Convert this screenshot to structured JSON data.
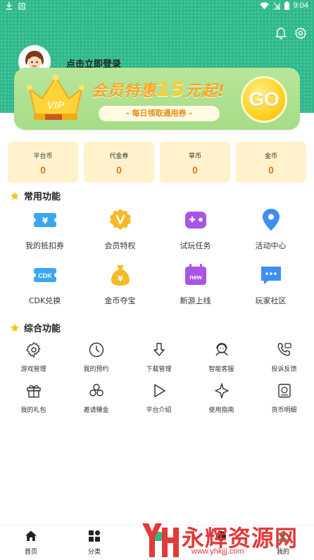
{
  "status_bar": {
    "time": "9:04"
  },
  "profile": {
    "login_prompt": "点击立即登录"
  },
  "vip_banner": {
    "crown_text": "VIP",
    "title_pre": "会员特惠",
    "title_num": "15",
    "title_post": "元起!",
    "subtitle": "- 每日领取通用券 -",
    "go_label": "GO"
  },
  "currencies": [
    {
      "label": "平台币",
      "value": "0"
    },
    {
      "label": "代金券",
      "value": "0"
    },
    {
      "label": "草币",
      "value": "0"
    },
    {
      "label": "金币",
      "value": "0"
    }
  ],
  "common_section": {
    "title": "常用功能",
    "items": [
      {
        "label": "我的抵扣券",
        "icon": "coupon-icon"
      },
      {
        "label": "会员特权",
        "icon": "vip-badge-icon"
      },
      {
        "label": "试玩任务",
        "icon": "gamepad-icon"
      },
      {
        "label": "活动中心",
        "icon": "location-pin-icon"
      },
      {
        "label": "CDK兑换",
        "icon": "cdk-icon",
        "badge": "CDK"
      },
      {
        "label": "金币夺宝",
        "icon": "money-bag-icon"
      },
      {
        "label": "新游上线",
        "icon": "new-calendar-icon",
        "badge": "new"
      },
      {
        "label": "玩家社区",
        "icon": "chat-bubble-icon"
      }
    ]
  },
  "general_section": {
    "title": "综合功能",
    "items": [
      {
        "label": "游戏管理",
        "icon": "gear-refresh-icon"
      },
      {
        "label": "我的预约",
        "icon": "clock-icon"
      },
      {
        "label": "下载管理",
        "icon": "download-arrow-icon"
      },
      {
        "label": "智能客服",
        "icon": "customer-service-icon"
      },
      {
        "label": "投诉反馈",
        "icon": "phone-feedback-icon"
      },
      {
        "label": "我的礼包",
        "icon": "gift-icon"
      },
      {
        "label": "邀请赚金",
        "icon": "coins-icon"
      },
      {
        "label": "平台介绍",
        "icon": "play-icon"
      },
      {
        "label": "使用指南",
        "icon": "sparkle-icon"
      },
      {
        "label": "货币明细",
        "icon": "currency-list-icon"
      }
    ]
  },
  "bottom_nav": {
    "items": [
      {
        "label": "首页",
        "icon": "home-icon"
      },
      {
        "label": "分类",
        "icon": "category-icon"
      },
      {
        "label": "",
        "icon": "trade-icon"
      },
      {
        "label": "",
        "icon": "discover-icon"
      },
      {
        "label": "我的",
        "icon": "profile-icon"
      }
    ]
  },
  "watermark": {
    "text": "永辉资源网",
    "url": "www.yhkjjj.com"
  },
  "colors": {
    "header_green": "#2eb98c",
    "accent_orange": "#e1761a",
    "card_bg": "#fff2cc",
    "vip_gold": "#ffd52a",
    "watermark_red": "#e03a3a"
  }
}
